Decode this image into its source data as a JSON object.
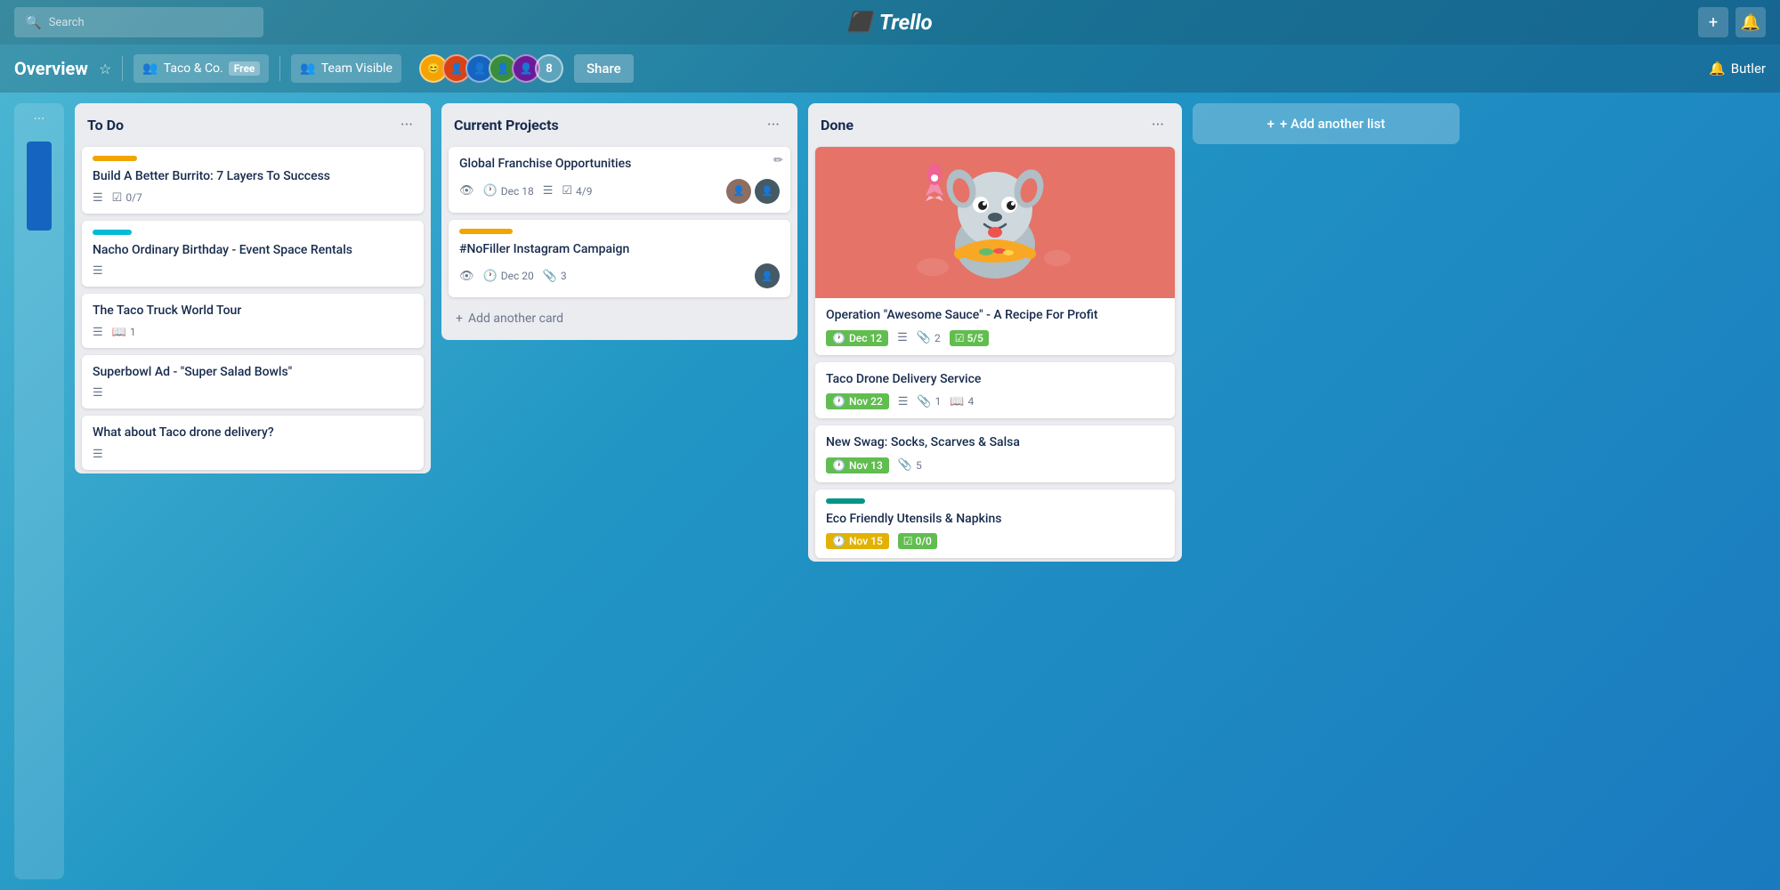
{
  "topbar": {
    "search_placeholder": "Search",
    "logo_text": "Trello",
    "plus_label": "+",
    "bell_label": "🔔"
  },
  "header": {
    "board_title": "Overview",
    "star_label": "☆",
    "workspace_icon": "👥",
    "workspace_name": "Taco & Co.",
    "free_badge": "Free",
    "team_icon": "👥",
    "team_name": "Team Visible",
    "member_count": "8",
    "share_label": "Share",
    "butler_icon": "🔔",
    "butler_label": "Butler"
  },
  "lists": [
    {
      "id": "todo",
      "title": "To Do",
      "cards": [
        {
          "id": "card1",
          "label_color": "orange",
          "title": "Build A Better Burrito: 7 Layers To Success",
          "has_desc": true,
          "checklist": "0/7"
        },
        {
          "id": "card2",
          "label_color": "cyan",
          "title": "Nacho Ordinary Birthday - Event Space Rentals",
          "has_desc": true
        },
        {
          "id": "card3",
          "title": "The Taco Truck World Tour",
          "has_desc": true,
          "attachment": "1"
        },
        {
          "id": "card4",
          "title": "Superbowl Ad - \"Super Salad Bowls\"",
          "has_desc": true
        },
        {
          "id": "card5",
          "title": "What about Taco drone delivery?",
          "has_desc": true
        }
      ]
    },
    {
      "id": "current",
      "title": "Current Projects",
      "cards": [
        {
          "id": "card6",
          "label_color": null,
          "title": "Global Franchise Opportunities",
          "due": "Dec 18",
          "has_desc": true,
          "checklist": "4/9",
          "avatars": [
            "brown",
            "dark"
          ],
          "has_edit": true
        },
        {
          "id": "card7",
          "label_color": "orange-cp",
          "title": "#NoFiller Instagram Campaign",
          "due": "Dec 20",
          "attachments": "3",
          "avatars": [
            "dark"
          ]
        }
      ],
      "add_card_label": "+ Add another card"
    },
    {
      "id": "done",
      "title": "Done",
      "cards": [
        {
          "id": "card8",
          "has_cover": true,
          "title": "Operation \"Awesome Sauce\" - A Recipe For Profit",
          "due": "Dec 12",
          "due_done": true,
          "has_desc": true,
          "attachments": "2",
          "checklist_done": "5/5"
        },
        {
          "id": "card9",
          "title": "Taco Drone Delivery Service",
          "due": "Nov 22",
          "due_done": true,
          "has_desc": true,
          "attachments": "1",
          "attachment_type": "book",
          "book_count": "4"
        },
        {
          "id": "card10",
          "title": "New Swag: Socks, Scarves & Salsa",
          "due": "Nov 13",
          "due_done": true,
          "attachments": "5"
        },
        {
          "id": "card11",
          "label_color": "teal",
          "title": "Eco Friendly Utensils & Napkins",
          "due": "Nov 15",
          "checklist_partial": "0/0"
        }
      ]
    }
  ],
  "add_list": {
    "label": "+ Add another list"
  }
}
